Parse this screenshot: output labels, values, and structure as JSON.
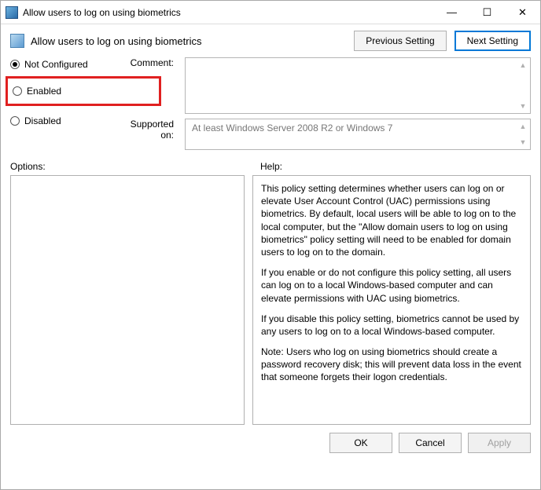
{
  "window": {
    "title": "Allow users to log on using biometrics"
  },
  "header": {
    "title": "Allow users to log on using biometrics",
    "previous_setting": "Previous Setting",
    "next_setting": "Next Setting"
  },
  "state_radios": {
    "not_configured": "Not Configured",
    "enabled": "Enabled",
    "disabled": "Disabled",
    "selected": "not_configured"
  },
  "labels": {
    "comment": "Comment:",
    "supported_on": "Supported on:",
    "options": "Options:",
    "help": "Help:"
  },
  "supported_on_text": "At least Windows Server 2008 R2 or Windows 7",
  "help_paragraphs": {
    "p1": "This policy setting determines whether users can log on or elevate User Account Control (UAC) permissions using biometrics.  By default, local users will be able to log on to the local computer, but the \"Allow domain users to log on using biometrics\" policy setting will need to be enabled for domain users to log on to the domain.",
    "p2": "If you enable or do not configure this policy setting, all users can log on to a local Windows-based computer and can elevate permissions with UAC using biometrics.",
    "p3": "If you disable this policy setting, biometrics cannot be used by any users to log on to a local Windows-based computer.",
    "p4": "Note: Users who log on using biometrics should create a password recovery disk; this will prevent data loss in the event that someone forgets their logon credentials."
  },
  "footer": {
    "ok": "OK",
    "cancel": "Cancel",
    "apply": "Apply"
  }
}
